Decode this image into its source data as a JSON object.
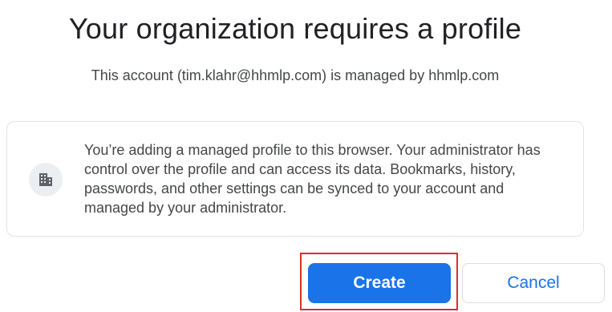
{
  "header": {
    "title": "Your organization requires a profile",
    "subtitle": "This account (tim.klahr@hhmlp.com) is managed by hhmlp.com"
  },
  "info_card": {
    "icon": "building-icon",
    "text": "You’re adding a managed profile to this browser. Your administrator has control over the profile and can access its data. Bookmarks, history, passwords, and other settings can be synced to your account and managed by your administrator."
  },
  "actions": {
    "create_label": "Create",
    "cancel_label": "Cancel"
  },
  "colors": {
    "accent": "#1a73e8",
    "highlight": "#d93025"
  }
}
